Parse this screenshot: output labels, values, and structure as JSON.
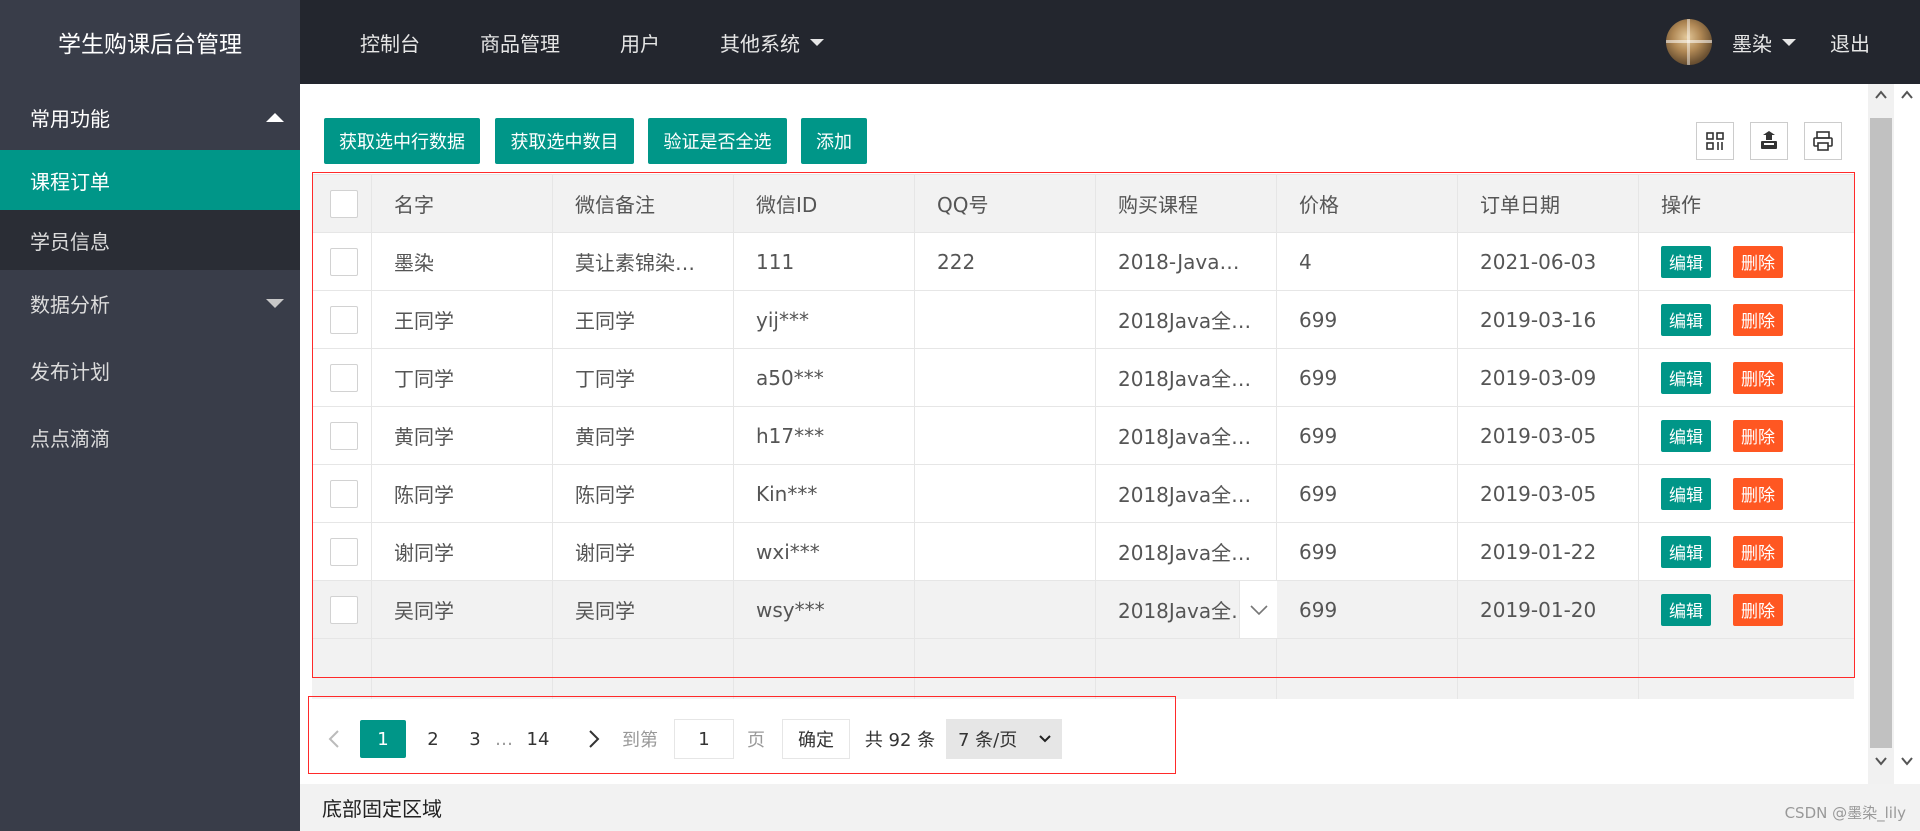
{
  "header": {
    "logo": "学生购课后台管理",
    "nav": [
      {
        "label": "控制台"
      },
      {
        "label": "商品管理"
      },
      {
        "label": "用户"
      },
      {
        "label": "其他系统"
      }
    ],
    "user_name": "墨染",
    "logout": "退出"
  },
  "sidebar": {
    "group_label": "常用功能",
    "sub_items": [
      {
        "label": "课程订单",
        "active": true
      },
      {
        "label": "学员信息",
        "active": false
      }
    ],
    "items": [
      {
        "label": "数据分析"
      },
      {
        "label": "发布计划"
      },
      {
        "label": "点点滴滴"
      }
    ]
  },
  "toolbar": {
    "buttons": [
      {
        "label": "获取选中行数据"
      },
      {
        "label": "获取选中数目"
      },
      {
        "label": "验证是否全选"
      },
      {
        "label": "添加"
      }
    ],
    "icons": [
      "columns-filter-icon",
      "export-icon",
      "print-icon"
    ]
  },
  "table": {
    "columns": [
      "名字",
      "微信备注",
      "微信ID",
      "QQ号",
      "购买课程",
      "价格",
      "订单日期",
      "操作"
    ],
    "rows": [
      {
        "name": "墨染",
        "wx_note": "莫让素锦染…",
        "wx_id": "111",
        "qq": "222",
        "course": "2018-Java…",
        "price": "4",
        "date": "2021-06-03"
      },
      {
        "name": "王同学",
        "wx_note": "王同学",
        "wx_id": "yij***",
        "qq": "",
        "course": "2018Java全…",
        "price": "699",
        "date": "2019-03-16"
      },
      {
        "name": "丁同学",
        "wx_note": "丁同学",
        "wx_id": "a50***",
        "qq": "",
        "course": "2018Java全…",
        "price": "699",
        "date": "2019-03-09"
      },
      {
        "name": "黄同学",
        "wx_note": "黄同学",
        "wx_id": "h17***",
        "qq": "",
        "course": "2018Java全…",
        "price": "699",
        "date": "2019-03-05"
      },
      {
        "name": "陈同学",
        "wx_note": "陈同学",
        "wx_id": "Kin***",
        "qq": "",
        "course": "2018Java全…",
        "price": "699",
        "date": "2019-03-05"
      },
      {
        "name": "谢同学",
        "wx_note": "谢同学",
        "wx_id": "wxi***",
        "qq": "",
        "course": "2018Java全…",
        "price": "699",
        "date": "2019-01-22"
      },
      {
        "name": "吴同学",
        "wx_note": "吴同学",
        "wx_id": "wsy***",
        "qq": "",
        "course": "2018Java全…",
        "price": "699",
        "date": "2019-01-20"
      }
    ],
    "edit_label": "编辑",
    "delete_label": "删除"
  },
  "pager": {
    "pages": [
      "1",
      "2",
      "3",
      "…",
      "14"
    ],
    "current": "1",
    "goto_label": "到第",
    "goto_value": "1",
    "page_unit": "页",
    "confirm": "确定",
    "total": "共 92 条",
    "per_page": "7 条/页"
  },
  "footer": {
    "text": "底部固定区域",
    "watermark": "CSDN @墨染_lily"
  },
  "colors": {
    "primary": "#009688",
    "danger": "#ff5722",
    "header_bg": "#23262e",
    "sidebar_bg": "#393d49",
    "highlight_border": "#ff2a2a"
  }
}
